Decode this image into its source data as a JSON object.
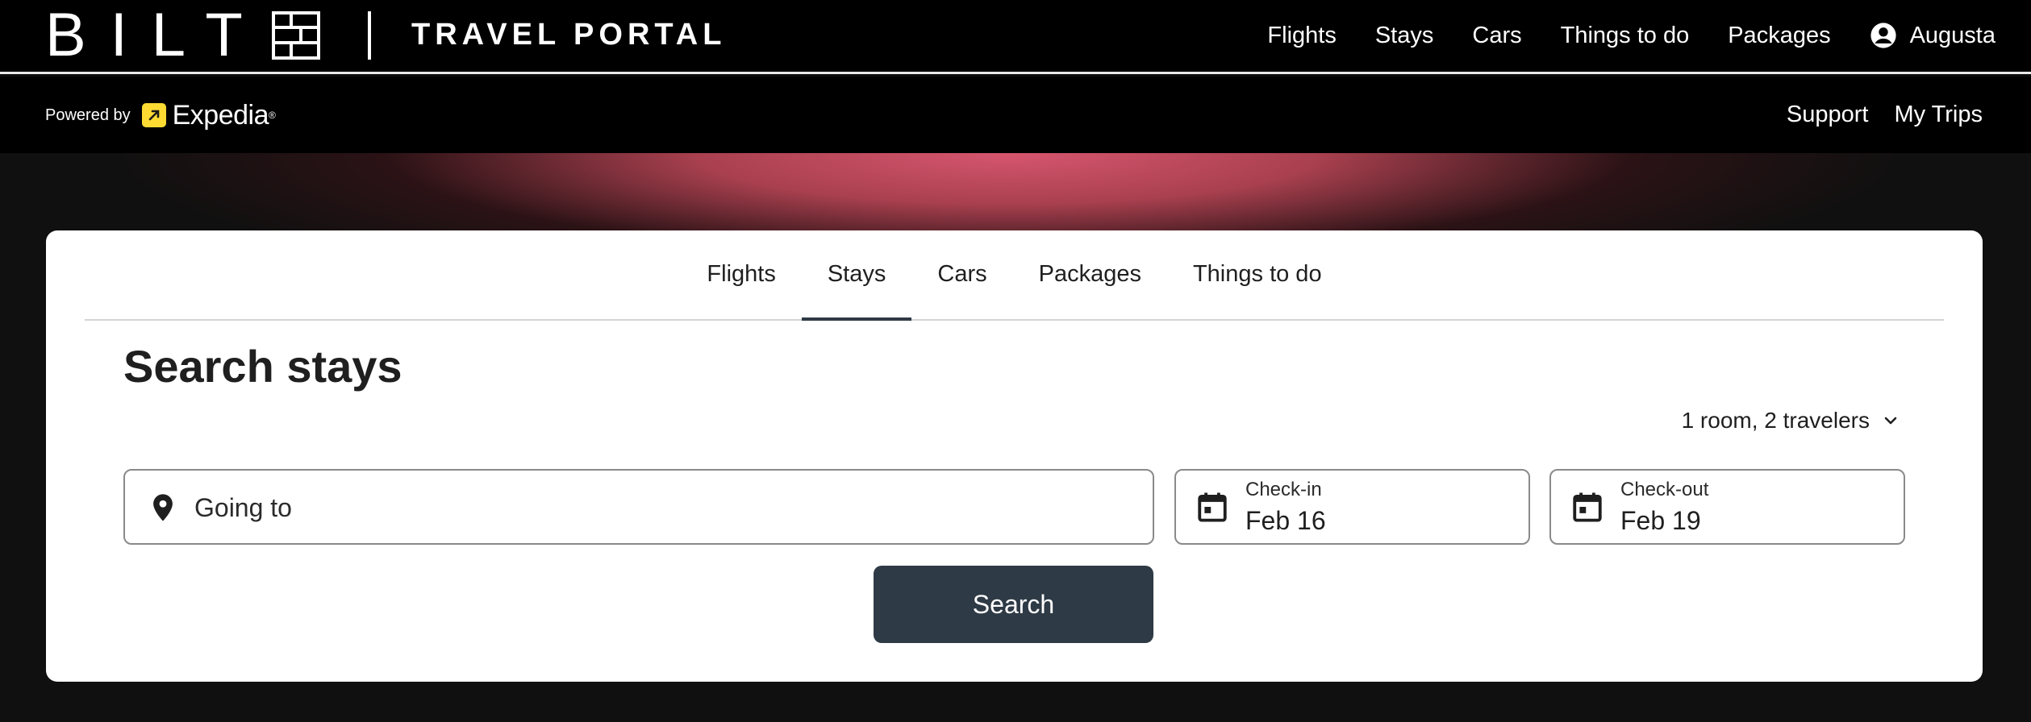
{
  "brand": {
    "logo_text": "BILT",
    "portal_title": "TRAVEL PORTAL"
  },
  "top_nav": {
    "items": [
      {
        "label": "Flights"
      },
      {
        "label": "Stays"
      },
      {
        "label": "Cars"
      },
      {
        "label": "Things to do"
      },
      {
        "label": "Packages"
      }
    ],
    "account_name": "Augusta",
    "account_icon": "account-circle-icon"
  },
  "sub_bar": {
    "powered_by_label": "Powered by",
    "partner_name": "Expedia",
    "partner_mark": "®",
    "links": [
      {
        "label": "Support"
      },
      {
        "label": "My Trips"
      }
    ]
  },
  "search_card": {
    "tabs": [
      {
        "label": "Flights",
        "active": false
      },
      {
        "label": "Stays",
        "active": true
      },
      {
        "label": "Cars",
        "active": false
      },
      {
        "label": "Packages",
        "active": false
      },
      {
        "label": "Things to do",
        "active": false
      }
    ],
    "title": "Search stays",
    "travelers_label": "1 room, 2 travelers",
    "destination": {
      "placeholder": "Going to",
      "value": ""
    },
    "check_in": {
      "label": "Check-in",
      "value": "Feb 16"
    },
    "check_out": {
      "label": "Check-out",
      "value": "Feb 19"
    },
    "search_button_label": "Search"
  },
  "colors": {
    "header_bg": "#000000",
    "accent_button": "#2e3a45",
    "hero_glow": "#d6566f",
    "expedia_yellow": "#fddb32"
  }
}
